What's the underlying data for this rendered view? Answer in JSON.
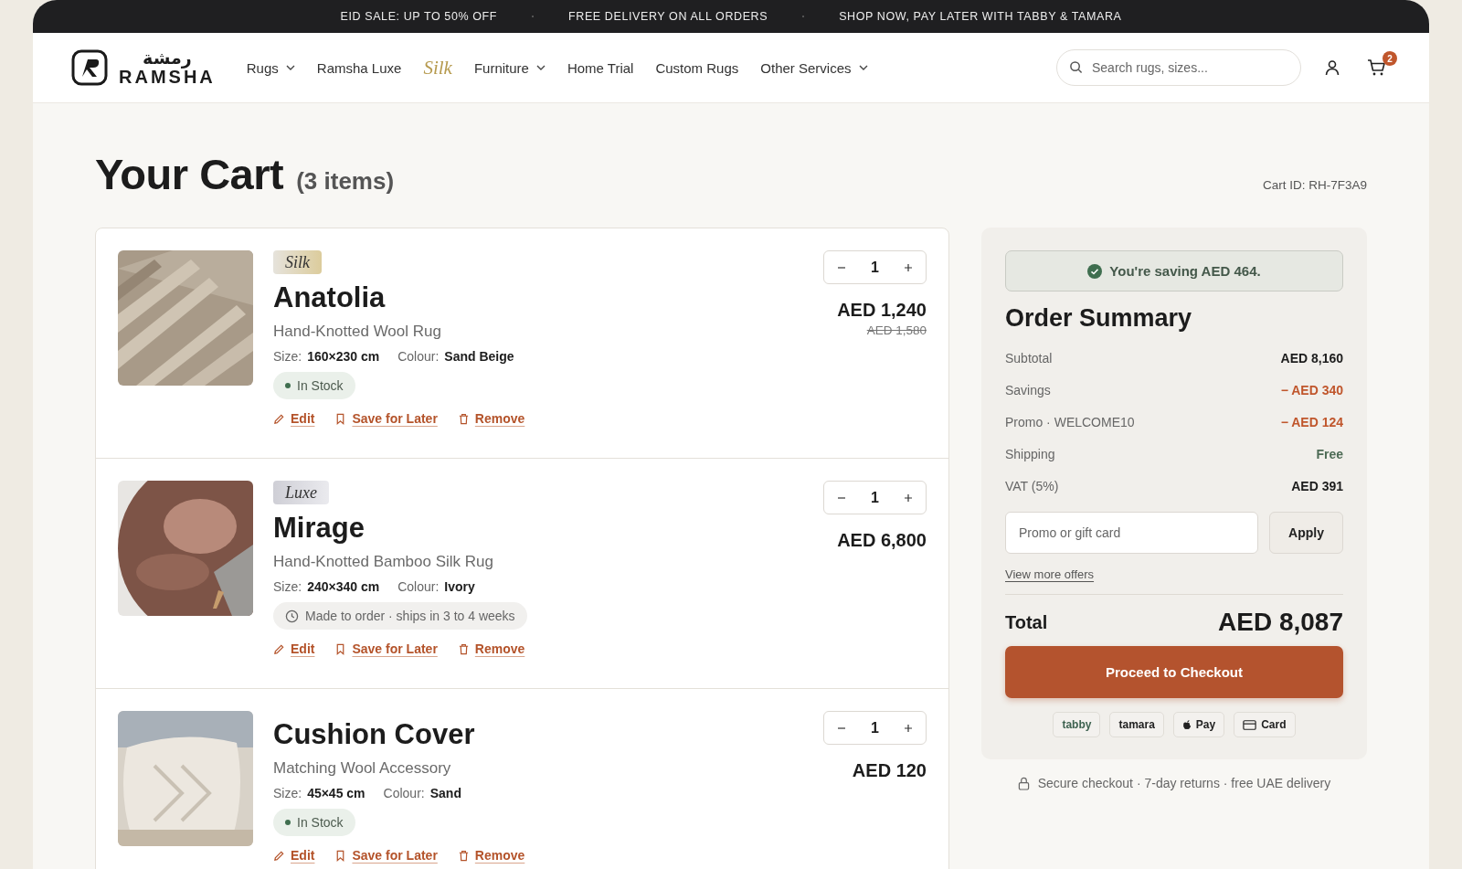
{
  "promo_bar": [
    "EID SALE: UP TO 50% OFF",
    "FREE DELIVERY ON ALL ORDERS",
    "SHOP NOW, PAY LATER WITH TABBY & TAMARA"
  ],
  "header": {
    "logo": {
      "arabic": "رمشة",
      "name": "RAMSHA"
    },
    "nav": [
      {
        "label": "Rugs",
        "kind": "dropdown"
      },
      {
        "label": "Ramsha Luxe",
        "kind": "link"
      },
      {
        "label": "Silk",
        "kind": "script"
      },
      {
        "label": "Furniture",
        "kind": "dropdown"
      },
      {
        "label": "Home Trial",
        "kind": "link"
      },
      {
        "label": "Custom Rugs",
        "kind": "link"
      },
      {
        "label": "Other Services",
        "kind": "dropdown"
      }
    ],
    "search": {
      "placeholder": "Search rugs, sizes..."
    },
    "cart_count": "2"
  },
  "page": {
    "title": "Your Cart",
    "count": "(3 items)",
    "cart_id": "Cart ID: RH-7F3A9"
  },
  "items": [
    {
      "badge": {
        "label": "Silk",
        "kind": "silk"
      },
      "name": "Anatolia",
      "subtitle": "Hand-Knotted Wool Rug",
      "size_label": "Size:",
      "size": "160×230 cm",
      "colour_label": "Colour:",
      "colour": "Sand Beige",
      "stock": {
        "kind": "in_stock",
        "label": "In Stock"
      },
      "quantity": "1",
      "price": "AED 1,240",
      "old_price": "AED 1,580",
      "actions": [
        "Edit",
        "Save for Later",
        "Remove"
      ]
    },
    {
      "badge": {
        "label": "Luxe",
        "kind": "luxe"
      },
      "name": "Mirage",
      "subtitle": "Hand-Knotted Bamboo Silk Rug",
      "size_label": "Size:",
      "size": "240×340 cm",
      "colour_label": "Colour:",
      "colour": "Ivory",
      "stock": {
        "kind": "made_to_order",
        "label": "Made to order · ships in 3 to 4 weeks"
      },
      "quantity": "1",
      "price": "AED 6,800",
      "actions": [
        "Edit",
        "Save for Later",
        "Remove"
      ]
    },
    {
      "name": "Cushion Cover",
      "subtitle": "Matching Wool Accessory",
      "size_label": "Size:",
      "size": "45×45 cm",
      "colour_label": "Colour:",
      "colour": "Sand",
      "stock": {
        "kind": "in_stock",
        "label": "In Stock"
      },
      "quantity": "1",
      "price": "AED 120",
      "actions": [
        "Edit",
        "Save for Later",
        "Remove"
      ]
    }
  ],
  "summary": {
    "saving_banner": "You're saving AED 464.",
    "title": "Order Summary",
    "rows": [
      {
        "label": "Subtotal",
        "value": "AED 8,160",
        "kind": "normal"
      },
      {
        "label": "Savings",
        "value": "− AED 340",
        "kind": "discount"
      },
      {
        "label": "Promo · WELCOME10",
        "value": "− AED 124",
        "kind": "discount"
      },
      {
        "label": "Shipping",
        "value": "Free",
        "kind": "free"
      },
      {
        "label": "VAT (5%)",
        "value": "AED 391",
        "kind": "normal"
      }
    ],
    "promo_field": {
      "placeholder": "Promo or gift card"
    },
    "apply_button": "Apply",
    "offers_link": "View more offers",
    "total_label": "Total",
    "total": "AED 8,087",
    "checkout_button": "Proceed to Checkout",
    "payment_methods": [
      {
        "label": "tabby",
        "kind": "tabby"
      },
      {
        "label": "tamara",
        "kind": "tamara"
      },
      {
        "label": "Pay",
        "kind": "apple"
      },
      {
        "label": "Card",
        "kind": "card"
      }
    ],
    "footnote": "Secure checkout · 7-day returns · free UAE delivery"
  }
}
